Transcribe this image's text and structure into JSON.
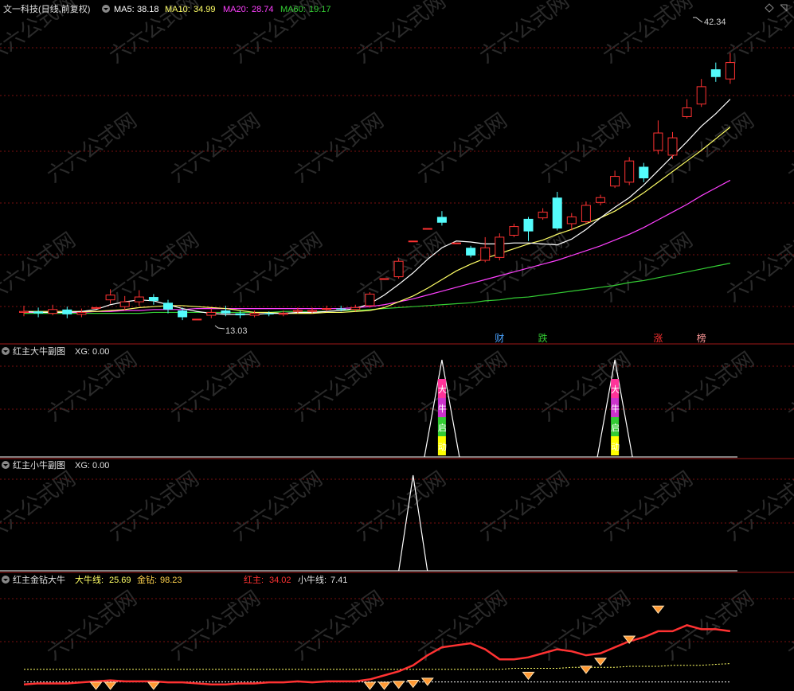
{
  "title": "文一科技(日线,前复权)",
  "colors": {
    "bg": "#000000",
    "up": "#ff3232",
    "down": "#54fcfc",
    "grid": "#7a1010",
    "ma5": "#ffffff",
    "ma10": "#ffff66",
    "ma20": "#ff40ff",
    "ma60": "#33cc33",
    "gold": "#ffd24d",
    "orange": "#ff9933"
  },
  "panel1": {
    "ma5_label": "MA5:",
    "ma5_value": "38.18",
    "ma10_label": "MA10:",
    "ma10_value": "34.99",
    "ma20_label": "MA20:",
    "ma20_value": "28.74",
    "ma60_label": "MA60:",
    "ma60_value": "19.17",
    "high_label": "42.34",
    "low_label": "13.03",
    "event_tags": [
      {
        "text": "财",
        "bar": 33,
        "color": "#4aa3ff"
      },
      {
        "text": "跌",
        "bar": 36,
        "color": "#33cc33"
      },
      {
        "text": "涨",
        "bar": 44,
        "color": "#ff3232"
      },
      {
        "text": "榜",
        "bar": 47,
        "color": "#ff9999"
      }
    ]
  },
  "panel2": {
    "title": "红主大牛副图",
    "xg_label": "XG:",
    "xg_value": "0.00",
    "peak_text": [
      "大",
      "牛",
      "启",
      "动"
    ]
  },
  "panel3": {
    "title": "红主小牛副图",
    "xg_label": "XG:",
    "xg_value": "0.00"
  },
  "panel4": {
    "title": "红主金钻大牛",
    "daniu_label": "大牛线:",
    "daniu_value": "25.69",
    "jinzuan_label": "金钻:",
    "jinzuan_value": "98.23",
    "hongzhu_label": "红主:",
    "hongzhu_value": "34.02",
    "xiaoniu_label": "小牛线:",
    "xiaoniu_value": "7.41"
  },
  "watermark": "六六公式网",
  "chart_data": {
    "type": "candlestick",
    "ylim": [
      11,
      45
    ],
    "candles": [
      {
        "o": 14.1,
        "c": 14.2,
        "h": 14.8,
        "l": 13.7
      },
      {
        "o": 14.2,
        "c": 14.0,
        "h": 14.6,
        "l": 13.6
      },
      {
        "o": 14.0,
        "c": 14.4,
        "h": 14.9,
        "l": 13.8
      },
      {
        "o": 14.4,
        "c": 13.9,
        "h": 14.7,
        "l": 13.5
      },
      {
        "o": 13.9,
        "c": 14.1,
        "h": 14.5,
        "l": 13.6
      },
      {
        "o": 14.6,
        "c": 14.6,
        "h": 14.6,
        "l": 14.6
      },
      {
        "o": 15.4,
        "c": 15.9,
        "h": 16.5,
        "l": 15.0
      },
      {
        "o": 14.7,
        "c": 15.2,
        "h": 15.8,
        "l": 14.3
      },
      {
        "o": 15.2,
        "c": 15.7,
        "h": 16.4,
        "l": 14.8
      },
      {
        "o": 15.7,
        "c": 15.3,
        "h": 16.0,
        "l": 14.9
      },
      {
        "o": 15.1,
        "c": 14.4,
        "h": 15.4,
        "l": 14.0
      },
      {
        "o": 14.3,
        "c": 13.6,
        "h": 14.6,
        "l": 13.3
      },
      {
        "o": 13.4,
        "c": 13.4,
        "h": 13.4,
        "l": 13.4
      },
      {
        "o": 13.8,
        "c": 14.1,
        "h": 14.5,
        "l": 13.5
      },
      {
        "o": 14.3,
        "c": 14.0,
        "h": 14.8,
        "l": 13.7
      },
      {
        "o": 14.0,
        "c": 13.8,
        "h": 14.3,
        "l": 13.5
      },
      {
        "o": 13.8,
        "c": 14.0,
        "h": 14.3,
        "l": 13.6
      },
      {
        "o": 14.0,
        "c": 13.9,
        "h": 14.2,
        "l": 13.7
      },
      {
        "o": 13.9,
        "c": 14.0,
        "h": 14.3,
        "l": 13.7
      },
      {
        "o": 14.2,
        "c": 14.3,
        "h": 14.6,
        "l": 14.0
      },
      {
        "o": 14.2,
        "c": 14.3,
        "h": 14.6,
        "l": 14.0
      },
      {
        "o": 14.5,
        "c": 14.5,
        "h": 14.8,
        "l": 14.2
      },
      {
        "o": 14.5,
        "c": 14.4,
        "h": 14.8,
        "l": 14.2
      },
      {
        "o": 14.4,
        "c": 14.6,
        "h": 14.9,
        "l": 14.2
      },
      {
        "o": 14.8,
        "c": 16.0,
        "h": 16.2,
        "l": 14.6
      },
      {
        "o": 17.6,
        "c": 17.6,
        "h": 17.6,
        "l": 17.6
      },
      {
        "o": 17.8,
        "c": 19.4,
        "h": 19.7,
        "l": 17.6
      },
      {
        "o": 21.5,
        "c": 21.5,
        "h": 21.5,
        "l": 21.5
      },
      {
        "o": 22.8,
        "c": 22.8,
        "h": 22.8,
        "l": 22.8
      },
      {
        "o": 24.0,
        "c": 23.4,
        "h": 24.6,
        "l": 23.1
      },
      {
        "o": 21.3,
        "c": 21.3,
        "h": 21.3,
        "l": 21.3
      },
      {
        "o": 20.8,
        "c": 20.0,
        "h": 21.0,
        "l": 19.8
      },
      {
        "o": 19.5,
        "c": 20.8,
        "h": 21.9,
        "l": 19.3
      },
      {
        "o": 19.8,
        "c": 21.9,
        "h": 22.3,
        "l": 19.5
      },
      {
        "o": 22.1,
        "c": 23.0,
        "h": 23.3,
        "l": 21.9
      },
      {
        "o": 23.8,
        "c": 22.5,
        "h": 24.0,
        "l": 21.5
      },
      {
        "o": 23.9,
        "c": 24.5,
        "h": 24.9,
        "l": 23.7
      },
      {
        "o": 26.0,
        "c": 22.8,
        "h": 26.6,
        "l": 22.6
      },
      {
        "o": 23.3,
        "c": 24.0,
        "h": 24.4,
        "l": 22.6
      },
      {
        "o": 23.5,
        "c": 25.2,
        "h": 25.6,
        "l": 23.3
      },
      {
        "o": 25.5,
        "c": 26.0,
        "h": 26.3,
        "l": 25.2
      },
      {
        "o": 27.2,
        "c": 28.2,
        "h": 28.8,
        "l": 27.0
      },
      {
        "o": 27.6,
        "c": 29.8,
        "h": 30.2,
        "l": 27.3
      },
      {
        "o": 29.2,
        "c": 28.0,
        "h": 29.6,
        "l": 27.6
      },
      {
        "o": 30.9,
        "c": 32.7,
        "h": 34.0,
        "l": 30.5
      },
      {
        "o": 30.4,
        "c": 32.2,
        "h": 32.8,
        "l": 30.0
      },
      {
        "o": 34.4,
        "c": 35.3,
        "h": 36.2,
        "l": 34.2
      },
      {
        "o": 35.7,
        "c": 37.5,
        "h": 38.3,
        "l": 35.4
      },
      {
        "o": 39.3,
        "c": 38.5,
        "h": 40.0,
        "l": 38.0
      },
      {
        "o": 38.3,
        "c": 40.0,
        "h": 41.0,
        "l": 37.8
      }
    ],
    "ma5": [
      14.2,
      14.1,
      14.1,
      14.1,
      14.2,
      14.4,
      14.9,
      15.2,
      15.4,
      15.3,
      14.9,
      14.5,
      14.2,
      14.0,
      13.9,
      13.9,
      13.9,
      14.0,
      14.0,
      14.1,
      14.1,
      14.2,
      14.3,
      14.5,
      15.0,
      15.9,
      17.0,
      18.2,
      19.6,
      20.8,
      21.5,
      21.4,
      21.2,
      21.2,
      21.3,
      21.3,
      21.2,
      21.1,
      21.7,
      22.7,
      23.9,
      25.0,
      26.0,
      27.3,
      28.8,
      30.3,
      31.8,
      33.4,
      34.7,
      36.2
    ],
    "ma10": [
      14.2,
      14.2,
      14.2,
      14.2,
      14.2,
      14.2,
      14.3,
      14.4,
      14.6,
      14.7,
      14.8,
      14.8,
      14.7,
      14.6,
      14.5,
      14.3,
      14.1,
      14.1,
      14.0,
      14.0,
      14.0,
      14.1,
      14.1,
      14.2,
      14.3,
      14.6,
      15.2,
      15.8,
      16.6,
      17.5,
      18.4,
      19.1,
      19.7,
      20.2,
      20.7,
      21.2,
      21.6,
      22.2,
      22.7,
      23.3,
      23.9,
      24.6,
      25.5,
      26.5,
      27.6,
      28.7,
      29.8,
      30.9,
      32.1,
      33.3
    ],
    "ma20": [
      14.1,
      14.1,
      14.1,
      14.1,
      14.1,
      14.2,
      14.2,
      14.3,
      14.3,
      14.4,
      14.4,
      14.4,
      14.5,
      14.5,
      14.5,
      14.5,
      14.5,
      14.5,
      14.5,
      14.5,
      14.5,
      14.5,
      14.5,
      14.6,
      14.7,
      14.9,
      15.2,
      15.5,
      15.9,
      16.3,
      16.7,
      17.1,
      17.5,
      17.9,
      18.3,
      18.7,
      19.1,
      19.5,
      20.0,
      20.5,
      21.0,
      21.6,
      22.2,
      22.9,
      23.7,
      24.5,
      25.3,
      26.2,
      27.0,
      27.8
    ],
    "ma60": [
      14.0,
      14.0,
      14.0,
      14.0,
      14.0,
      14.0,
      14.0,
      14.0,
      14.0,
      14.1,
      14.1,
      14.1,
      14.1,
      14.1,
      14.1,
      14.1,
      14.1,
      14.1,
      14.2,
      14.2,
      14.2,
      14.2,
      14.3,
      14.3,
      14.4,
      14.5,
      14.6,
      14.7,
      14.8,
      14.9,
      15.0,
      15.1,
      15.3,
      15.4,
      15.6,
      15.7,
      15.9,
      16.1,
      16.3,
      16.5,
      16.7,
      16.9,
      17.2,
      17.4,
      17.7,
      18.0,
      18.3,
      18.6,
      18.9,
      19.2
    ],
    "panel2_spikes": [
      29,
      41
    ],
    "panel3_spikes": [
      27
    ],
    "panel4": {
      "ylim": [
        0,
        100
      ],
      "hongzhu": [
        5,
        6,
        6,
        6,
        7,
        8,
        9,
        8,
        8,
        8,
        7,
        7,
        6,
        5,
        5,
        6,
        6,
        7,
        7,
        8,
        7,
        8,
        8,
        8,
        10,
        14,
        18,
        24,
        34,
        42,
        44,
        46,
        40,
        30,
        30,
        32,
        36,
        40,
        38,
        34,
        36,
        42,
        48,
        52,
        58,
        58,
        64,
        60,
        60,
        58
      ],
      "daniu": [
        20,
        20,
        20,
        20,
        20,
        20,
        20,
        20,
        20,
        20,
        20,
        20,
        20,
        20,
        20,
        20,
        20,
        20,
        20,
        20,
        20,
        20,
        20,
        20,
        20,
        20,
        20,
        20,
        20,
        20,
        20,
        20,
        20,
        20,
        21,
        21,
        21,
        21,
        22,
        22,
        22,
        22,
        23,
        23,
        23,
        24,
        24,
        24,
        25,
        25.7
      ],
      "xiaoniu": [
        7.4,
        7.4,
        7.4,
        7.4,
        7.4,
        7.4,
        7.4,
        7.4,
        7.4,
        7.4,
        7.4,
        7.4,
        7.4,
        7.4,
        7.4,
        7.4,
        7.4,
        7.4,
        7.4,
        7.4,
        7.4,
        7.4,
        7.4,
        7.4,
        7.4,
        7.4,
        7.4,
        7.4,
        7.4,
        7.4,
        7.4,
        7.4,
        7.4,
        7.4,
        7.4,
        7.4,
        7.4,
        7.4,
        7.4,
        7.4,
        7.4,
        7.4,
        7.4,
        7.4,
        7.4,
        7.4,
        7.4,
        7.4,
        7.4,
        7.4
      ],
      "diamonds": [
        {
          "bar": 5,
          "v": 4
        },
        {
          "bar": 6,
          "v": 4
        },
        {
          "bar": 9,
          "v": 4
        },
        {
          "bar": 24,
          "v": 4
        },
        {
          "bar": 25,
          "v": 4
        },
        {
          "bar": 26,
          "v": 5
        },
        {
          "bar": 27,
          "v": 6
        },
        {
          "bar": 28,
          "v": 8
        },
        {
          "bar": 35,
          "v": 14
        },
        {
          "bar": 39,
          "v": 20
        },
        {
          "bar": 40,
          "v": 28
        },
        {
          "bar": 42,
          "v": 50
        },
        {
          "bar": 44,
          "v": 80
        }
      ]
    }
  }
}
